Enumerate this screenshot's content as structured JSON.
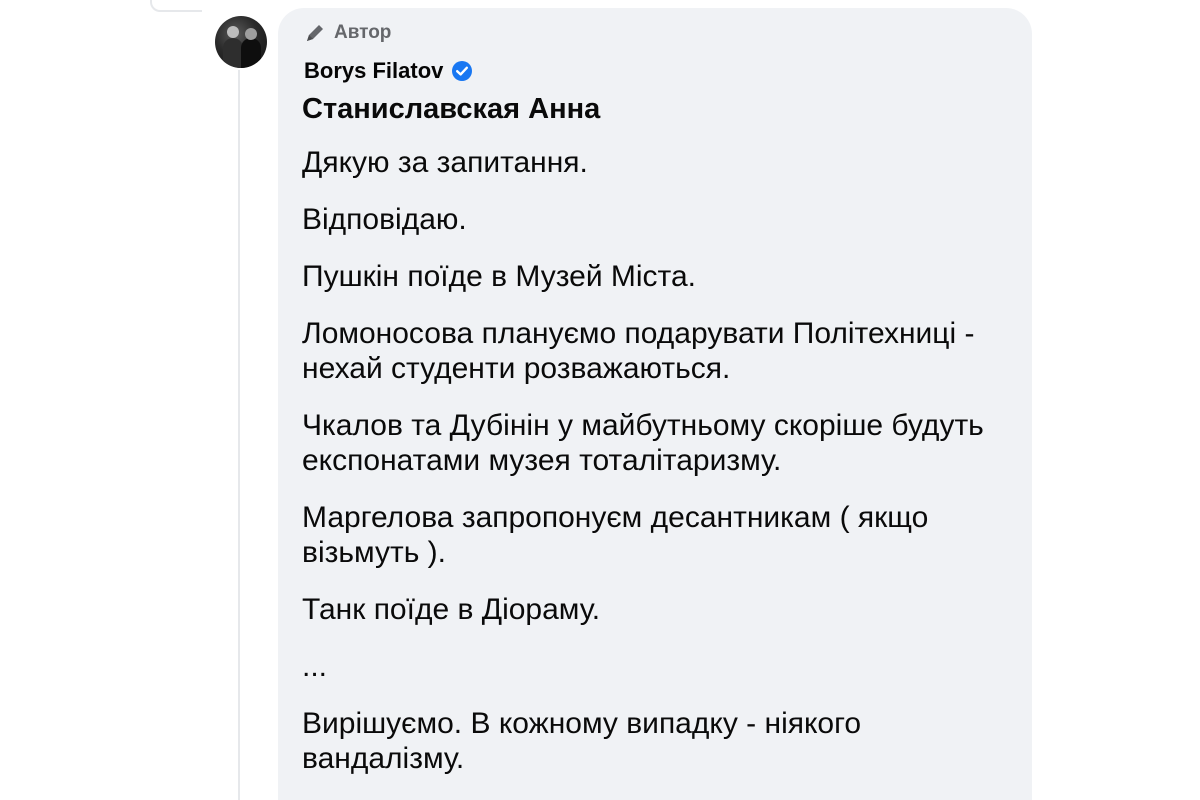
{
  "comment": {
    "author_badge": "Автор",
    "author_name": "Borys Filatov",
    "mention": "Станиславская Анна",
    "paragraphs": [
      "Дякую за запитання.",
      "Відповідаю.",
      "Пушкін поїде в Музей Міста.",
      "Ломоносова плануємо подарувати Політехниці - нехай студенти розважаються.",
      "Чкалов та Дубінін у майбутньому скоріше будуть експонатами музея тоталітаризму.",
      "Маргелова запропонуєм десантникам ( якщо візьмуть ).",
      "Танк поїде в Діораму.",
      "...",
      "Вирішуємо. В кожному випадку - ніякого вандалізму."
    ]
  },
  "icons": {
    "author_badge_icon": "pencil-icon",
    "verified_icon": "verified-badge-icon"
  },
  "colors": {
    "bubble_background": "#f0f2f5",
    "verified_blue": "#1877f2",
    "secondary_text": "#65676b"
  }
}
